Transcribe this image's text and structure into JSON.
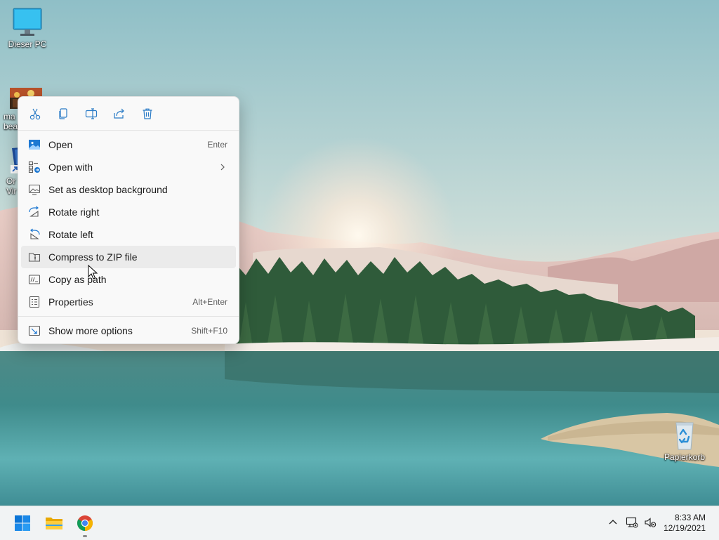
{
  "desktop": {
    "icons": [
      {
        "label": "Dieser PC",
        "icon": "monitor-icon"
      },
      {
        "label": "ma beat",
        "icon": "image-file-icon"
      },
      {
        "label": "Or Vir",
        "icon": "app-shortcut-icon"
      },
      {
        "label": "Papierkorb",
        "icon": "recycle-bin-icon"
      }
    ]
  },
  "context_menu": {
    "toolbar": [
      {
        "name": "cut",
        "icon": "scissors-icon"
      },
      {
        "name": "copy",
        "icon": "copy-icon"
      },
      {
        "name": "rename",
        "icon": "rename-icon"
      },
      {
        "name": "share",
        "icon": "share-icon"
      },
      {
        "name": "delete",
        "icon": "trash-icon"
      }
    ],
    "items": [
      {
        "label": "Open",
        "shortcut": "Enter",
        "icon": "image-icon"
      },
      {
        "label": "Open with",
        "shortcut": "",
        "icon": "open-with-icon",
        "submenu": true
      },
      {
        "label": "Set as desktop background",
        "shortcut": "",
        "icon": "wallpaper-icon"
      },
      {
        "label": "Rotate right",
        "shortcut": "",
        "icon": "rotate-right-icon"
      },
      {
        "label": "Rotate left",
        "shortcut": "",
        "icon": "rotate-left-icon"
      },
      {
        "label": "Compress to ZIP file",
        "shortcut": "",
        "icon": "zip-icon",
        "hovered": true
      },
      {
        "label": "Copy as path",
        "shortcut": "",
        "icon": "copy-path-icon"
      },
      {
        "label": "Properties",
        "shortcut": "Alt+Enter",
        "icon": "properties-icon"
      },
      {
        "label": "Show more options",
        "shortcut": "Shift+F10",
        "icon": "more-options-icon"
      }
    ]
  },
  "taskbar": {
    "apps": [
      {
        "name": "start",
        "icon": "windows-start-icon"
      },
      {
        "name": "file-explorer",
        "icon": "folder-icon"
      },
      {
        "name": "chrome",
        "icon": "chrome-icon",
        "running": true
      }
    ],
    "tray": {
      "icons": [
        "chevron-up-icon",
        "network-icon",
        "volume-muted-icon"
      ],
      "time": "8:33 AM",
      "date": "12/19/2021"
    }
  },
  "colors": {
    "accent": "#0067c0",
    "menu_bg": "#f9f9f9",
    "hover_bg": "#ebebeb",
    "taskbar_bg": "#f1f3f4"
  }
}
